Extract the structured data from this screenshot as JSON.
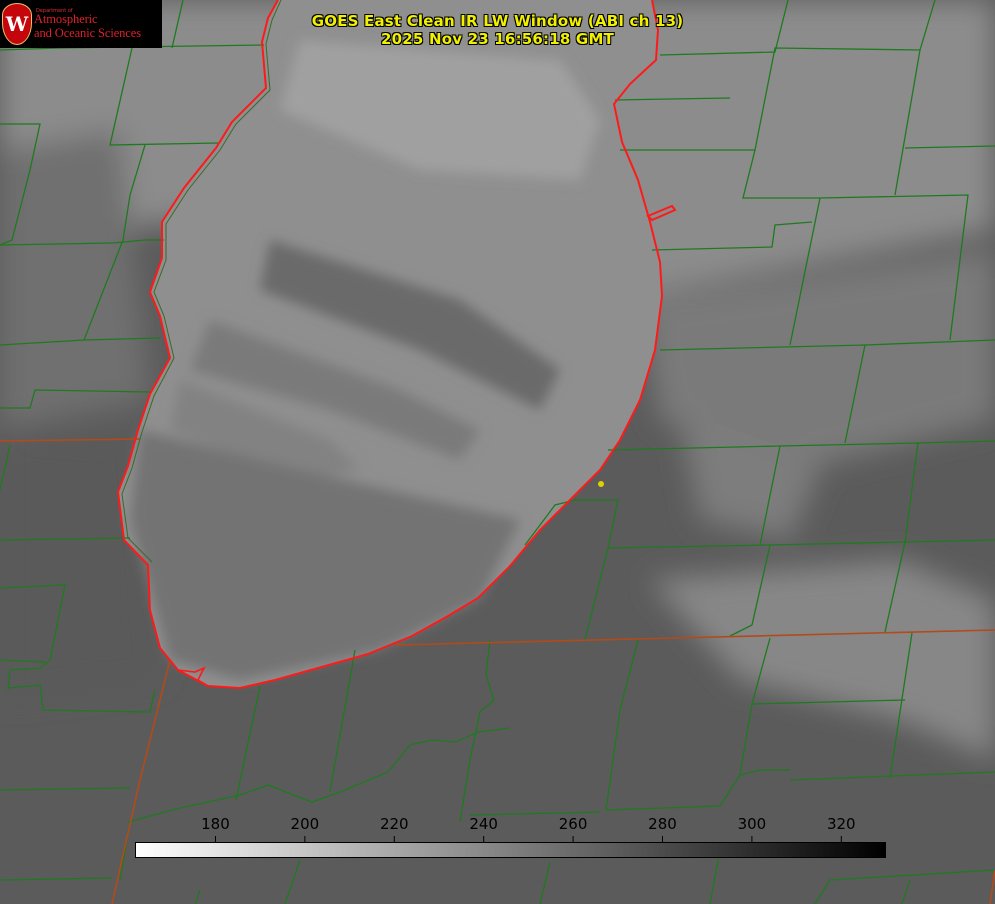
{
  "title": {
    "line1": "GOES East Clean IR LW Window (ABI ch 13)",
    "line2": "2025 Nov 23 16:56:18 GMT"
  },
  "logo": {
    "dept": "Department of",
    "line1": "Atmospheric",
    "line2": "and Oceanic Sciences",
    "seal_letter": "W"
  },
  "colorbar": {
    "ticks": [
      "180",
      "200",
      "220",
      "240",
      "260",
      "280",
      "300",
      "320"
    ],
    "range": [
      162,
      330
    ],
    "start_color": "#ffffff",
    "end_color": "#000000"
  },
  "colors": {
    "title_text": "#f0f000",
    "lake_outline": "#ff1a1a",
    "county_lines": "#1f7a1f",
    "state_lines": "#b34a1a",
    "logo_text": "#e0202a",
    "marker": "#e0d000"
  }
}
